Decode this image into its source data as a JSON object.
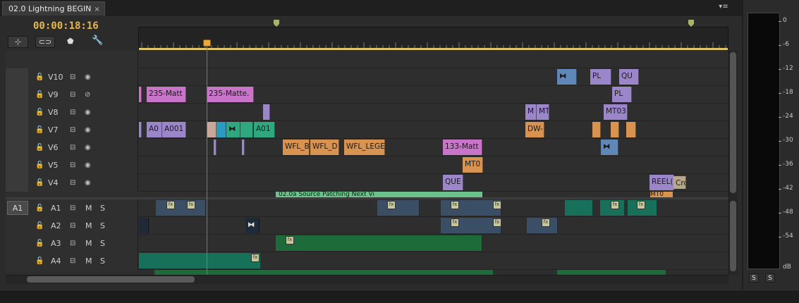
{
  "panel": {
    "tab_title": "02.0 Lightning BEGIN",
    "tab_close": "×",
    "menu_glyph": "▾≡",
    "timecode": "00:00:18:16"
  },
  "tools": {
    "snap_icon": "snap-icon",
    "linked_icon": "linked-selection-icon",
    "marker_icon": "add-marker-icon",
    "wrench_icon": "timeline-settings-icon"
  },
  "source_patch": "A1",
  "video_tracks": [
    {
      "name": "V10",
      "eye_off": false
    },
    {
      "name": "V9",
      "eye_off": true
    },
    {
      "name": "V8",
      "eye_off": false
    },
    {
      "name": "V7",
      "eye_off": false
    },
    {
      "name": "V6",
      "eye_off": false
    },
    {
      "name": "V5",
      "eye_off": false
    },
    {
      "name": "V4",
      "eye_off": false
    }
  ],
  "audio_tracks": [
    {
      "name": "A1",
      "m": "M",
      "s": "S"
    },
    {
      "name": "A2",
      "m": "M",
      "s": "S"
    },
    {
      "name": "A3",
      "m": "M",
      "s": "S"
    },
    {
      "name": "A4",
      "m": "M",
      "s": "S"
    }
  ],
  "clips": {
    "v10": [
      "PL",
      "QU"
    ],
    "v9": [
      "235-Matt",
      "235-Matte.",
      "PL"
    ],
    "v8": [
      "M",
      "MT",
      "MT03"
    ],
    "v7": [
      "A0",
      "A001",
      "A01",
      "DW-"
    ],
    "v6": [
      "WFL_B",
      "WFL_D",
      "WFL_LEGE",
      "133-Matt"
    ],
    "v5": [
      "MT0"
    ],
    "v4": [
      "QUE",
      "REEL(",
      "Cro"
    ],
    "partial": [
      "02.0a Source Patching Next Vi",
      "MT0"
    ]
  },
  "meter": {
    "scale": [
      "0",
      "-6",
      "-12",
      "-18",
      "-24",
      "-30",
      "-36",
      "-42",
      "-48",
      "-54"
    ],
    "unit": "dB",
    "solo_left": "S",
    "solo_right": "S"
  },
  "colors": {
    "playhead": "#e0503c",
    "timecode": "#e9b64a",
    "work_area": "#e0c46a"
  }
}
